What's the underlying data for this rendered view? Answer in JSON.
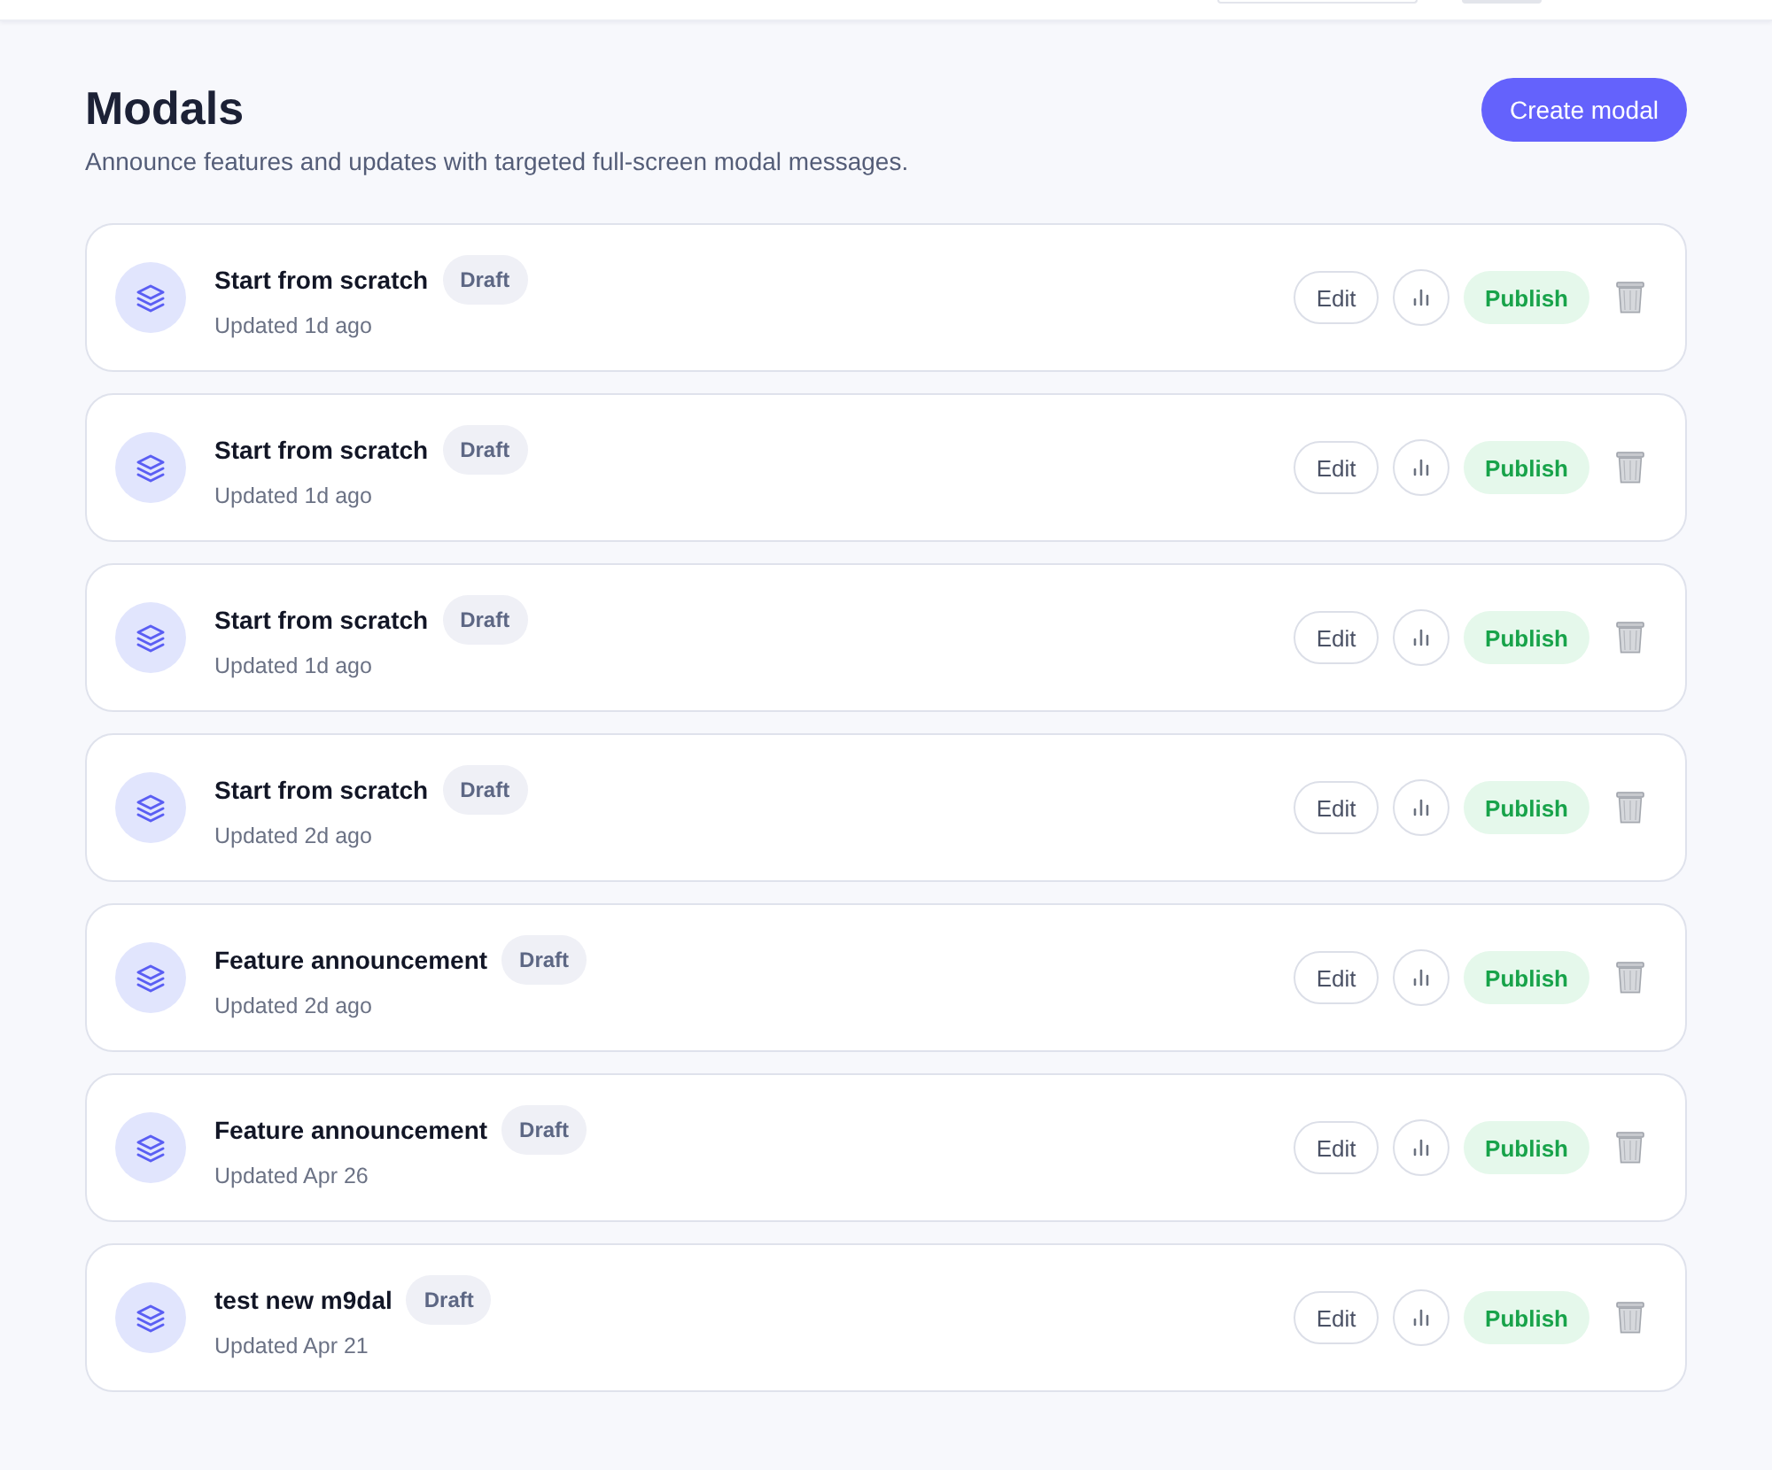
{
  "header": {
    "controls": [
      {
        "kind": "outlined"
      },
      {
        "kind": "filled"
      }
    ]
  },
  "page": {
    "title": "Modals",
    "subtitle": "Announce features and updates with targeted full-screen modal messages.",
    "create_button": "Create modal"
  },
  "modals": [
    {
      "name": "Start from scratch",
      "status": "Draft",
      "updated": "Updated 1d ago",
      "edit_label": "Edit",
      "publish_label": "Publish"
    },
    {
      "name": "Start from scratch",
      "status": "Draft",
      "updated": "Updated 1d ago",
      "edit_label": "Edit",
      "publish_label": "Publish"
    },
    {
      "name": "Start from scratch",
      "status": "Draft",
      "updated": "Updated 1d ago",
      "edit_label": "Edit",
      "publish_label": "Publish"
    },
    {
      "name": "Start from scratch",
      "status": "Draft",
      "updated": "Updated 2d ago",
      "edit_label": "Edit",
      "publish_label": "Publish"
    },
    {
      "name": "Feature announcement",
      "status": "Draft",
      "updated": "Updated 2d ago",
      "edit_label": "Edit",
      "publish_label": "Publish"
    },
    {
      "name": "Feature announcement",
      "status": "Draft",
      "updated": "Updated Apr 26",
      "edit_label": "Edit",
      "publish_label": "Publish"
    },
    {
      "name": "test new m9dal",
      "status": "Draft",
      "updated": "Updated Apr 21",
      "edit_label": "Edit",
      "publish_label": "Publish"
    }
  ]
}
